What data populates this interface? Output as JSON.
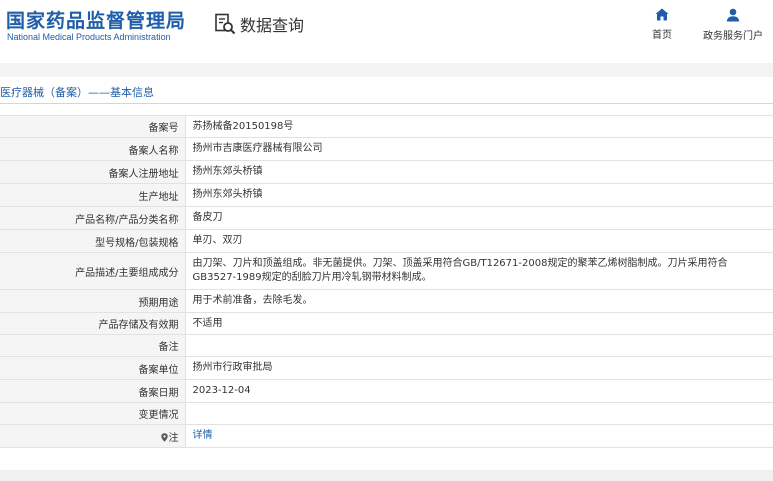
{
  "header": {
    "logo_cn": "国家药品监督管理局",
    "logo_en": "National Medical Products Administration",
    "query_label": "数据查询",
    "nav_home": "首页",
    "nav_service": "政务服务门户"
  },
  "section_title": "医疗器械（备案）——基本信息",
  "rows": [
    {
      "key": "备案号",
      "value": "苏扬械备20150198号"
    },
    {
      "key": "备案人名称",
      "value": "扬州市吉康医疗器械有限公司"
    },
    {
      "key": "备案人注册地址",
      "value": "扬州东郊头桥镇"
    },
    {
      "key": "生产地址",
      "value": "扬州东郊头桥镇"
    },
    {
      "key": "产品名称/产品分类名称",
      "value": "备皮刀"
    },
    {
      "key": "型号规格/包装规格",
      "value": "单刃、双刃"
    },
    {
      "key": "产品描述/主要组成成分",
      "value": "由刀架、刀片和顶盖组成。非无菌提供。刀架、顶盖采用符合GB/T12671-2008规定的聚苯乙烯树脂制成。刀片采用符合GB3527-1989规定的刮脸刀片用冷轧钢带材料制成。"
    },
    {
      "key": "预期用途",
      "value": "用于术前准备，去除毛发。"
    },
    {
      "key": "产品存储及有效期",
      "value": "不适用"
    },
    {
      "key": "备注",
      "value": ""
    },
    {
      "key": "备案单位",
      "value": "扬州市行政审批局"
    },
    {
      "key": "备案日期",
      "value": "2023-12-04"
    },
    {
      "key": "变更情况",
      "value": ""
    },
    {
      "key": "注",
      "value": "详情"
    }
  ],
  "colors": {
    "brand": "#1f5ea8",
    "label_bg": "#f5f5f5",
    "border": "#e2e2e2"
  }
}
